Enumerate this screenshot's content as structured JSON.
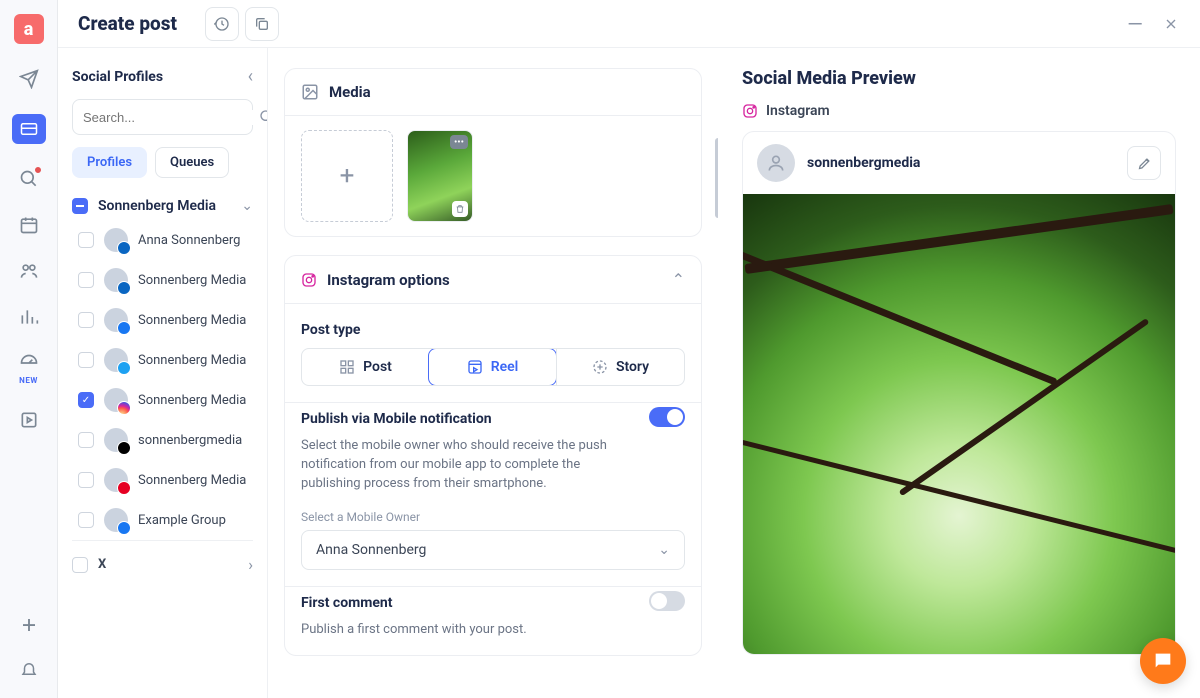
{
  "leftRail": {
    "newBadge": "NEW"
  },
  "titlebar": {
    "title": "Create post"
  },
  "sidebar": {
    "title": "Social Profiles",
    "searchPlaceholder": "Search...",
    "tabs": {
      "profiles": "Profiles",
      "queues": "Queues"
    },
    "group": {
      "name": "Sonnenberg Media"
    },
    "profiles": [
      {
        "label": "Anna Sonnenberg",
        "network": "linkedin",
        "checked": false
      },
      {
        "label": "Sonnenberg Media",
        "network": "linkedin",
        "checked": false
      },
      {
        "label": "Sonnenberg Media",
        "network": "facebook",
        "checked": false
      },
      {
        "label": "Sonnenberg Media",
        "network": "twitter",
        "checked": false
      },
      {
        "label": "Sonnenberg Media",
        "network": "instagram",
        "checked": true
      },
      {
        "label": "sonnenbergmedia",
        "network": "tiktok",
        "checked": false
      },
      {
        "label": "Sonnenberg Media",
        "network": "pinterest",
        "checked": false
      },
      {
        "label": "Example Group",
        "network": "facebook",
        "checked": false
      }
    ],
    "footer": {
      "label": "X"
    }
  },
  "editor": {
    "media": {
      "title": "Media"
    },
    "instagram": {
      "title": "Instagram options",
      "postType": {
        "label": "Post type",
        "options": {
          "post": "Post",
          "reel": "Reel",
          "story": "Story"
        }
      },
      "mobile": {
        "title": "Publish via Mobile notification",
        "helper": "Select the mobile owner who should receive the push notification from our mobile app to complete the publishing process from their smartphone.",
        "selectLabel": "Select a Mobile Owner",
        "selected": "Anna Sonnenberg"
      },
      "firstComment": {
        "title": "First comment",
        "helper": "Publish a first comment with your post."
      }
    }
  },
  "preview": {
    "title": "Social Media Preview",
    "platform": "Instagram",
    "username": "sonnenbergmedia"
  }
}
